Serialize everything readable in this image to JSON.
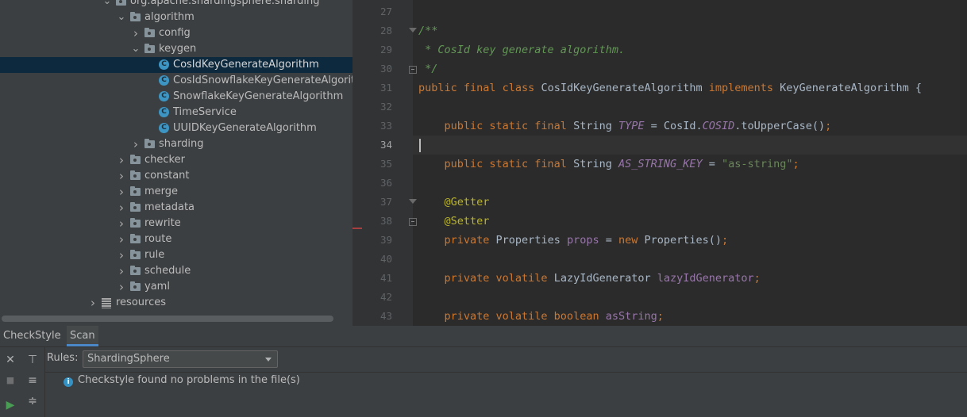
{
  "tree": {
    "items": [
      {
        "label": "org.apache.shardingsphere.sharding",
        "kind": "package",
        "expanded": true
      },
      {
        "label": "algorithm",
        "kind": "package",
        "expanded": true
      },
      {
        "label": "config",
        "kind": "package",
        "expanded": false
      },
      {
        "label": "keygen",
        "kind": "package",
        "expanded": true
      },
      {
        "label": "CosIdKeyGenerateAlgorithm",
        "kind": "class",
        "selected": true
      },
      {
        "label": "CosIdSnowflakeKeyGenerateAlgorithm",
        "kind": "class"
      },
      {
        "label": "SnowflakeKeyGenerateAlgorithm",
        "kind": "class"
      },
      {
        "label": "TimeService",
        "kind": "class"
      },
      {
        "label": "UUIDKeyGenerateAlgorithm",
        "kind": "class"
      },
      {
        "label": "sharding",
        "kind": "package",
        "expanded": false
      },
      {
        "label": "checker",
        "kind": "package",
        "expanded": false
      },
      {
        "label": "constant",
        "kind": "package",
        "expanded": false
      },
      {
        "label": "merge",
        "kind": "package",
        "expanded": false
      },
      {
        "label": "metadata",
        "kind": "package",
        "expanded": false
      },
      {
        "label": "rewrite",
        "kind": "package",
        "expanded": false
      },
      {
        "label": "route",
        "kind": "package",
        "expanded": false
      },
      {
        "label": "rule",
        "kind": "package",
        "expanded": false
      },
      {
        "label": "schedule",
        "kind": "package",
        "expanded": false
      },
      {
        "label": "yaml",
        "kind": "package",
        "expanded": false
      },
      {
        "label": "resources",
        "kind": "resources",
        "expanded": false
      }
    ],
    "class_icon_letter": "C"
  },
  "editor": {
    "current_line": "34",
    "lines": [
      {
        "n": "27",
        "tokens": []
      },
      {
        "n": "28",
        "tokens": [
          {
            "t": "/**",
            "c": "cm"
          }
        ]
      },
      {
        "n": "29",
        "tokens": [
          {
            "t": " * CosId key generate algorithm.",
            "c": "cm"
          }
        ]
      },
      {
        "n": "30",
        "tokens": [
          {
            "t": " */",
            "c": "cm"
          }
        ]
      },
      {
        "n": "31",
        "tokens": [
          {
            "t": "public final class ",
            "c": "k"
          },
          {
            "t": "CosIdKeyGenerateAlgorithm ",
            "c": "plain"
          },
          {
            "t": "implements ",
            "c": "k"
          },
          {
            "t": "KeyGenerateAlgorithm {",
            "c": "plain"
          }
        ]
      },
      {
        "n": "32",
        "tokens": []
      },
      {
        "n": "33",
        "tokens": [
          {
            "t": "    public static final ",
            "c": "k"
          },
          {
            "t": "String ",
            "c": "plain"
          },
          {
            "t": "TYPE",
            "c": "fld ital"
          },
          {
            "t": " = CosId.",
            "c": "plain"
          },
          {
            "t": "COSID",
            "c": "fld ital"
          },
          {
            "t": ".toUpperCase()",
            "c": "plain"
          },
          {
            "t": ";",
            "c": "k"
          }
        ]
      },
      {
        "n": "34",
        "tokens": []
      },
      {
        "n": "35",
        "tokens": [
          {
            "t": "    public static final ",
            "c": "k"
          },
          {
            "t": "String ",
            "c": "plain"
          },
          {
            "t": "AS_STRING_KEY",
            "c": "fld ital"
          },
          {
            "t": " = ",
            "c": "plain"
          },
          {
            "t": "\"as-string\"",
            "c": "str"
          },
          {
            "t": ";",
            "c": "k"
          }
        ]
      },
      {
        "n": "36",
        "tokens": []
      },
      {
        "n": "37",
        "tokens": [
          {
            "t": "    @Getter",
            "c": "ann"
          }
        ]
      },
      {
        "n": "38",
        "tokens": [
          {
            "t": "    @Setter",
            "c": "ann"
          }
        ]
      },
      {
        "n": "39",
        "tokens": [
          {
            "t": "    private ",
            "c": "k"
          },
          {
            "t": "Properties ",
            "c": "plain"
          },
          {
            "t": "props",
            "c": "fld"
          },
          {
            "t": " = ",
            "c": "plain"
          },
          {
            "t": "new ",
            "c": "k"
          },
          {
            "t": "Properties()",
            "c": "plain"
          },
          {
            "t": ";",
            "c": "k"
          }
        ]
      },
      {
        "n": "40",
        "tokens": []
      },
      {
        "n": "41",
        "tokens": [
          {
            "t": "    private volatile ",
            "c": "k"
          },
          {
            "t": "LazyIdGenerator ",
            "c": "plain"
          },
          {
            "t": "lazyIdGenerator",
            "c": "fld"
          },
          {
            "t": ";",
            "c": "k"
          }
        ]
      },
      {
        "n": "42",
        "tokens": []
      },
      {
        "n": "43",
        "tokens": [
          {
            "t": "    private volatile boolean ",
            "c": "k"
          },
          {
            "t": "asString",
            "c": "fld"
          },
          {
            "t": ";",
            "c": "k"
          }
        ]
      }
    ]
  },
  "bottom": {
    "tabs": [
      "CheckStyle",
      "Scan"
    ],
    "active_tab": "Scan",
    "rules_label": "Rules:",
    "rules_value": "ShardingSphere",
    "message": "Checkstyle found no problems in the file(s)"
  },
  "colors": {
    "keyword": "#cc7832",
    "comment": "#629755",
    "field": "#9876aa",
    "annotation": "#bbb529",
    "string": "#6a8759",
    "selection": "#0d293e"
  }
}
